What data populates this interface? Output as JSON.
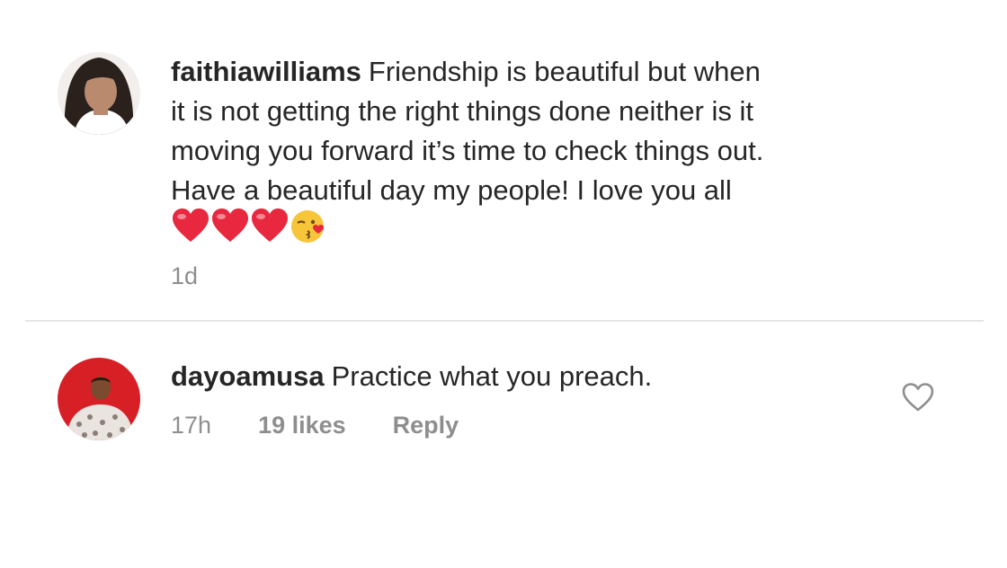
{
  "comments": [
    {
      "username": "faithiawilliams",
      "text_lines": [
        "Friendship is beautiful but when",
        "it is not getting the right things done neither is it",
        "moving you forward it’s time to check things out.",
        "Have a beautiful day my people! I love you all"
      ],
      "emojis": [
        "heart",
        "heart",
        "heart",
        "face-blowing-kiss"
      ],
      "time": "1d"
    },
    {
      "username": "dayoamusa",
      "text": "Practice what you preach.",
      "time": "17h",
      "likes": "19 likes",
      "reply_label": "Reply",
      "avatar_bg": "#d71f26"
    }
  ],
  "colors": {
    "text": "#262626",
    "meta": "#8e8e8e",
    "heart_emoji": "#e8283f",
    "divider": "#e6e6e6"
  }
}
